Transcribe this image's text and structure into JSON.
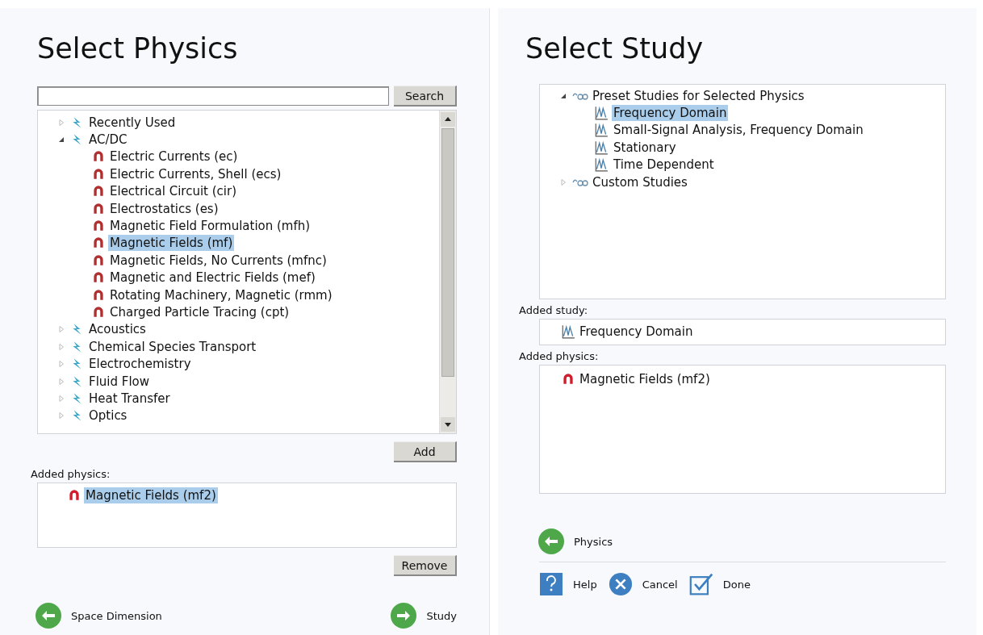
{
  "physics_panel": {
    "title": "Select Physics",
    "search": {
      "button": "Search"
    },
    "tree": [
      {
        "label": "Recently Used",
        "expanded": false,
        "selected": false
      },
      {
        "label": "AC/DC",
        "expanded": true,
        "selected": false,
        "children": [
          {
            "label": "Electric Currents (ec)",
            "selected": false
          },
          {
            "label": "Electric Currents, Shell (ecs)",
            "selected": false
          },
          {
            "label": "Electrical Circuit (cir)",
            "selected": false
          },
          {
            "label": "Electrostatics (es)",
            "selected": false
          },
          {
            "label": "Magnetic Field Formulation (mfh)",
            "selected": false
          },
          {
            "label": "Magnetic Fields (mf)",
            "selected": true
          },
          {
            "label": "Magnetic Fields, No Currents (mfnc)",
            "selected": false
          },
          {
            "label": "Magnetic and Electric Fields (mef)",
            "selected": false
          },
          {
            "label": "Rotating Machinery, Magnetic (rmm)",
            "selected": false
          },
          {
            "label": "Charged Particle Tracing (cpt)",
            "selected": false
          }
        ]
      },
      {
        "label": "Acoustics",
        "expanded": false,
        "selected": false
      },
      {
        "label": "Chemical Species Transport",
        "expanded": false,
        "selected": false
      },
      {
        "label": "Electrochemistry",
        "expanded": false,
        "selected": false
      },
      {
        "label": "Fluid Flow",
        "expanded": false,
        "selected": false
      },
      {
        "label": "Heat Transfer",
        "expanded": false,
        "selected": false
      },
      {
        "label": "Optics",
        "expanded": false,
        "selected": false
      }
    ],
    "add_button": "Add",
    "added_label": "Added physics:",
    "added": [
      {
        "label": "Magnetic Fields (mf2)",
        "selected": true
      }
    ],
    "remove_button": "Remove",
    "back": "Space Dimension",
    "next": "Study"
  },
  "study_panel": {
    "title": "Select Study",
    "tree": [
      {
        "label": "Preset Studies for Selected Physics",
        "expanded": true,
        "selected": false,
        "children": [
          {
            "label": "Frequency Domain",
            "selected": true
          },
          {
            "label": "Small-Signal Analysis, Frequency Domain",
            "selected": false
          },
          {
            "label": "Stationary",
            "selected": false
          },
          {
            "label": "Time Dependent",
            "selected": false
          }
        ]
      },
      {
        "label": "Custom Studies",
        "expanded": false,
        "selected": false
      }
    ],
    "added_study_label": "Added study:",
    "added_study": "Frequency Domain",
    "added_physics_label": "Added physics:",
    "added_physics": [
      {
        "label": "Magnetic Fields (mf2)",
        "selected": false
      }
    ],
    "back": "Physics",
    "buttons": {
      "help": "Help",
      "cancel": "Cancel",
      "done": "Done"
    }
  }
}
